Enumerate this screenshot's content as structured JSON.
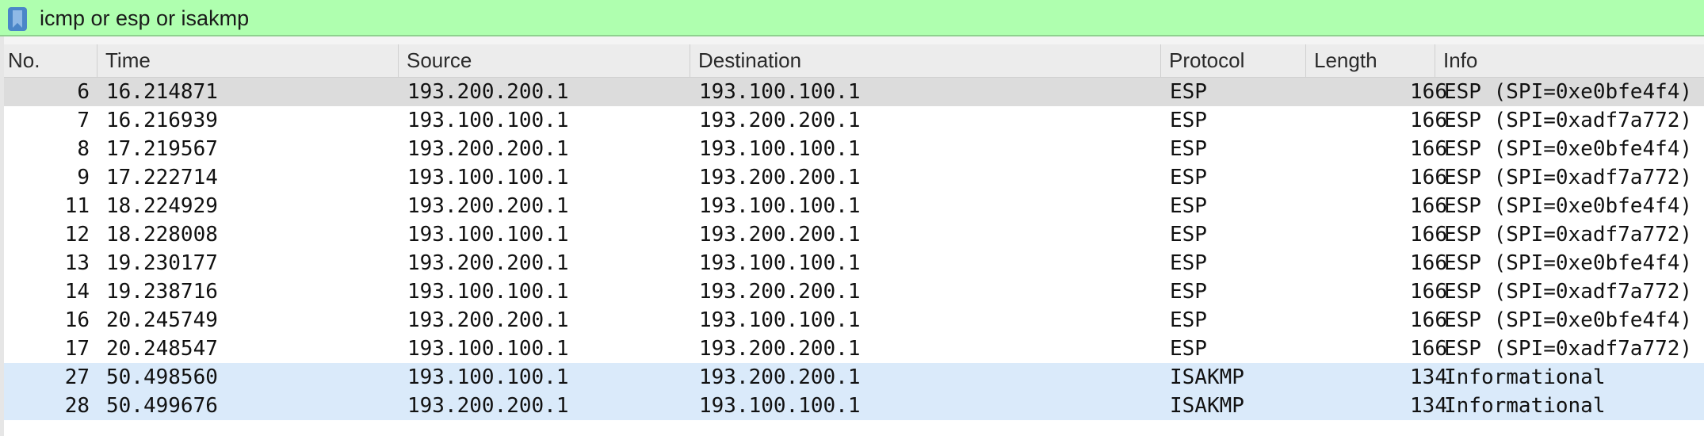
{
  "filter": {
    "text": "icmp or esp or isakmp",
    "bookmark_icon": "bookmark-icon",
    "background": "#afffaf"
  },
  "columns": [
    "No.",
    "Time",
    "Source",
    "Destination",
    "Protocol",
    "Length",
    "Info"
  ],
  "packets": [
    {
      "no": "6",
      "time": "16.214871",
      "source": "193.200.200.1",
      "destination": "193.100.100.1",
      "protocol": "ESP",
      "length": "166",
      "info": "ESP (SPI=0xe0bfe4f4)",
      "style": "sel"
    },
    {
      "no": "7",
      "time": "16.216939",
      "source": "193.100.100.1",
      "destination": "193.200.200.1",
      "protocol": "ESP",
      "length": "166",
      "info": "ESP (SPI=0xadf7a772)",
      "style": "esp"
    },
    {
      "no": "8",
      "time": "17.219567",
      "source": "193.200.200.1",
      "destination": "193.100.100.1",
      "protocol": "ESP",
      "length": "166",
      "info": "ESP (SPI=0xe0bfe4f4)",
      "style": "esp"
    },
    {
      "no": "9",
      "time": "17.222714",
      "source": "193.100.100.1",
      "destination": "193.200.200.1",
      "protocol": "ESP",
      "length": "166",
      "info": "ESP (SPI=0xadf7a772)",
      "style": "esp"
    },
    {
      "no": "11",
      "time": "18.224929",
      "source": "193.200.200.1",
      "destination": "193.100.100.1",
      "protocol": "ESP",
      "length": "166",
      "info": "ESP (SPI=0xe0bfe4f4)",
      "style": "esp"
    },
    {
      "no": "12",
      "time": "18.228008",
      "source": "193.100.100.1",
      "destination": "193.200.200.1",
      "protocol": "ESP",
      "length": "166",
      "info": "ESP (SPI=0xadf7a772)",
      "style": "esp"
    },
    {
      "no": "13",
      "time": "19.230177",
      "source": "193.200.200.1",
      "destination": "193.100.100.1",
      "protocol": "ESP",
      "length": "166",
      "info": "ESP (SPI=0xe0bfe4f4)",
      "style": "esp"
    },
    {
      "no": "14",
      "time": "19.238716",
      "source": "193.100.100.1",
      "destination": "193.200.200.1",
      "protocol": "ESP",
      "length": "166",
      "info": "ESP (SPI=0xadf7a772)",
      "style": "esp"
    },
    {
      "no": "16",
      "time": "20.245749",
      "source": "193.200.200.1",
      "destination": "193.100.100.1",
      "protocol": "ESP",
      "length": "166",
      "info": "ESP (SPI=0xe0bfe4f4)",
      "style": "esp"
    },
    {
      "no": "17",
      "time": "20.248547",
      "source": "193.100.100.1",
      "destination": "193.200.200.1",
      "protocol": "ESP",
      "length": "166",
      "info": "ESP (SPI=0xadf7a772)",
      "style": "esp"
    },
    {
      "no": "27",
      "time": "50.498560",
      "source": "193.100.100.1",
      "destination": "193.200.200.1",
      "protocol": "ISAKMP",
      "length": "134",
      "info": "Informational",
      "style": "isakmp"
    },
    {
      "no": "28",
      "time": "50.499676",
      "source": "193.200.200.1",
      "destination": "193.100.100.1",
      "protocol": "ISAKMP",
      "length": "134",
      "info": "Informational",
      "style": "isakmp"
    }
  ],
  "colors": {
    "selected_row": "#dcdcdc",
    "esp_row": "#ffffff",
    "isakmp_row": "#daeafa"
  }
}
